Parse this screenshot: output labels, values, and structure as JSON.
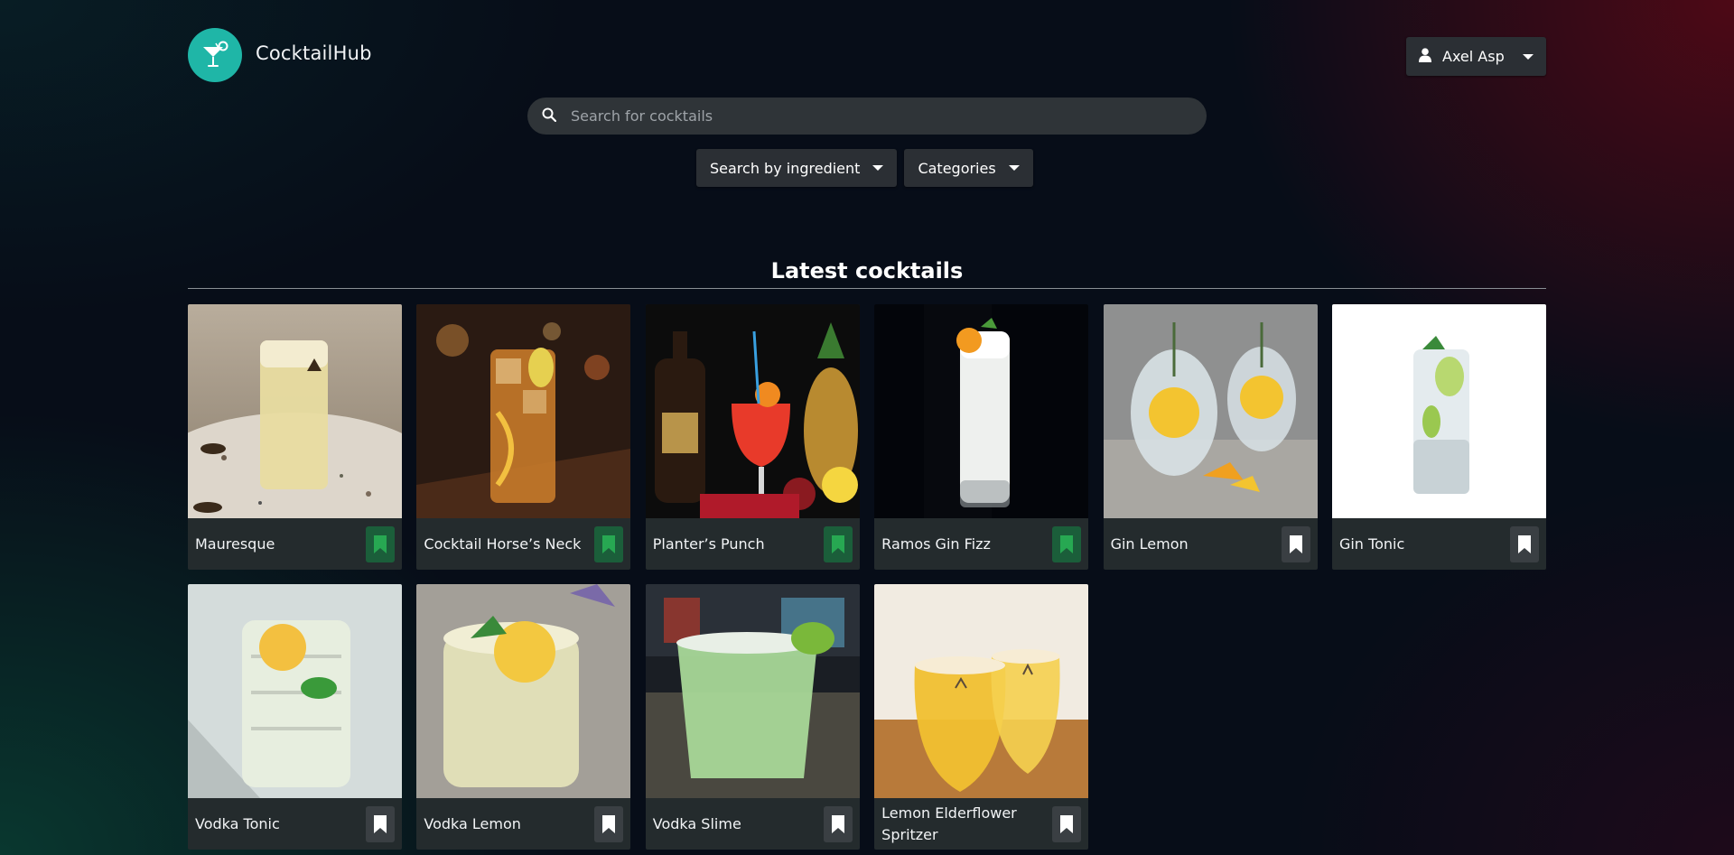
{
  "app": {
    "brand": "CocktailHub",
    "logo_icon": "cocktail-glass-icon"
  },
  "user": {
    "name": "Axel Asp"
  },
  "search": {
    "placeholder": "Search for cocktails"
  },
  "filters": {
    "ingredient_label": "Search by ingredient",
    "categories_label": "Categories"
  },
  "section": {
    "title": "Latest cocktails"
  },
  "colors": {
    "accent": "#1fb6a7",
    "saved": "#27a852",
    "card_bg": "#242b2d"
  },
  "cocktails": [
    {
      "name": "Mauresque",
      "saved": true
    },
    {
      "name": "Cocktail Horse’s Neck",
      "saved": true
    },
    {
      "name": "Planter’s Punch",
      "saved": true
    },
    {
      "name": "Ramos Gin Fizz",
      "saved": true
    },
    {
      "name": "Gin Lemon",
      "saved": false
    },
    {
      "name": "Gin Tonic",
      "saved": false
    },
    {
      "name": "Vodka Tonic",
      "saved": false
    },
    {
      "name": "Vodka Lemon",
      "saved": false
    },
    {
      "name": "Vodka Slime",
      "saved": false
    },
    {
      "name": "Lemon Elderflower Spritzer",
      "saved": false
    }
  ]
}
